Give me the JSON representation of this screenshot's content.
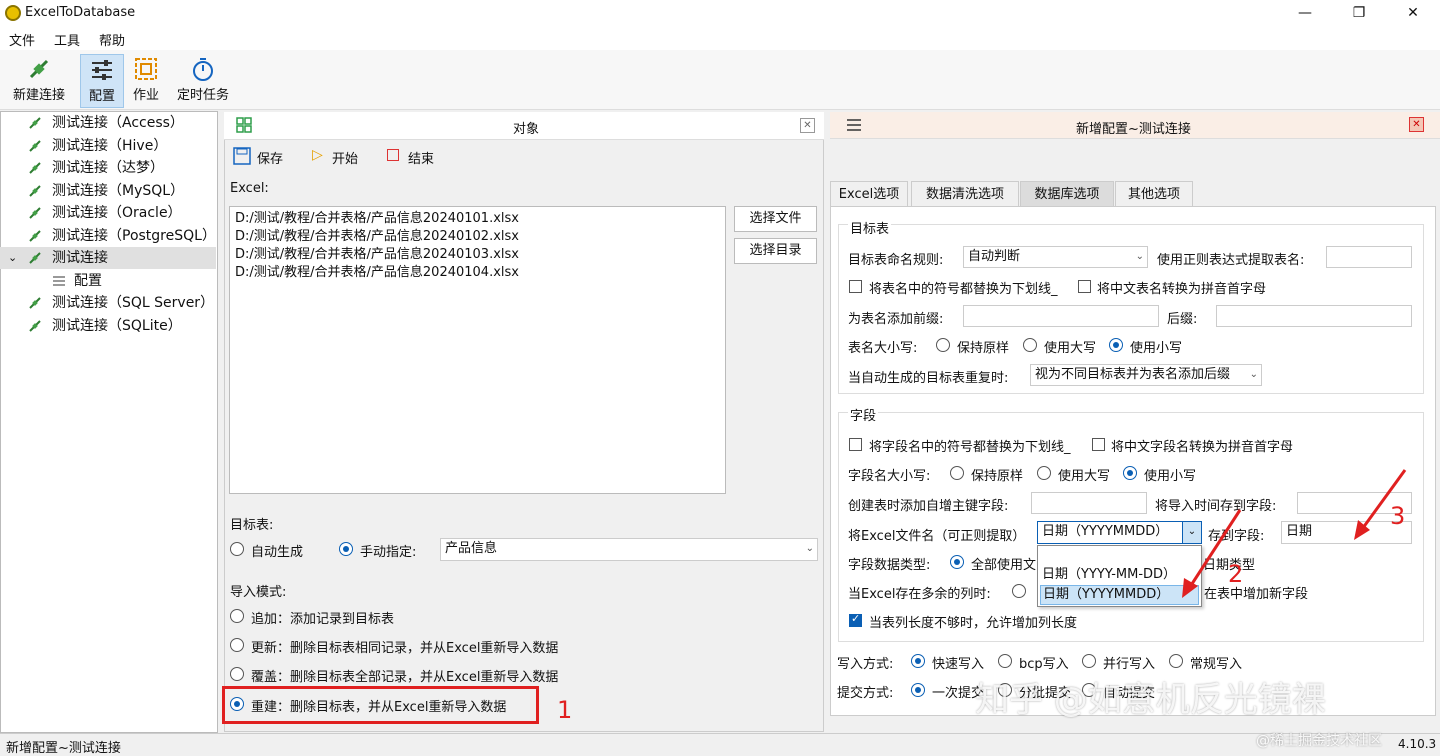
{
  "window": {
    "title": "ExcelToDatabase",
    "minimize": "—",
    "maximize": "❐",
    "close": "✕"
  },
  "menu": [
    "文件",
    "工具",
    "帮助"
  ],
  "toolbar": {
    "new_connection": "新建连接",
    "config": "配置",
    "job": "作业",
    "scheduled": "定时任务"
  },
  "tree": [
    "测试连接（Access）",
    "测试连接（Hive）",
    "测试连接（达梦）",
    "测试连接（MySQL）",
    "测试连接（Oracle）",
    "测试连接（PostgreSQL）",
    "测试连接",
    "配置",
    "测试连接（SQL Server）",
    "测试连接（SQLite）"
  ],
  "object_panel": {
    "title": "对象",
    "save": "保存",
    "start": "开始",
    "end": "结束",
    "excel_label": "Excel:",
    "files": [
      "D:/测试/教程/合并表格/产品信息20240101.xlsx",
      "D:/测试/教程/合并表格/产品信息20240102.xlsx",
      "D:/测试/教程/合并表格/产品信息20240103.xlsx",
      "D:/测试/教程/合并表格/产品信息20240104.xlsx"
    ],
    "select_file": "选择文件",
    "select_dir": "选择目录",
    "target_label": "目标表:",
    "auto_gen": "自动生成",
    "manual": "手动指定:",
    "target_value": "产品信息",
    "mode_label": "导入模式:",
    "modes": [
      "追加：添加记录到目标表",
      "更新：删除目标表相同记录，并从Excel重新导入数据",
      "覆盖：删除目标表全部记录，并从Excel重新导入数据",
      "重建：删除目标表，并从Excel重新导入数据"
    ]
  },
  "config_panel": {
    "title": "新增配置~测试连接",
    "tabs": [
      "Excel选项",
      "数据清洗选项",
      "数据库选项",
      "其他选项"
    ],
    "target_group": "目标表",
    "naming_rule_label": "目标表命名规则:",
    "naming_rule_value": "自动判断",
    "regex_label": "使用正则表达式提取表名:",
    "replace_symbols": "将表名中的符号都替换为下划线_",
    "pinyin_table": "将中文表名转换为拼音首字母",
    "prefix_label": "为表名添加前缀:",
    "suffix_label": "后缀:",
    "case_label": "表名大小写:",
    "keep": "保持原样",
    "upper": "使用大写",
    "lower": "使用小写",
    "dup_label": "当自动生成的目标表重复时:",
    "dup_value": "视为不同目标表并为表名添加后缀",
    "field_group": "字段",
    "replace_field_symbols": "将字段名中的符号都替换为下划线_",
    "pinyin_field": "将中文字段名转换为拼音首字母",
    "field_case_label": "字段名大小写:",
    "autoinc_label": "创建表时添加自增主键字段:",
    "import_time_label": "将导入时间存到字段:",
    "excel_name_label": "将Excel文件名（可正则提取）",
    "excel_name_value": "日期（YYYYMMDD）",
    "store_field_label": "存到字段:",
    "store_field_value": "日期",
    "data_type_label": "字段数据类型:",
    "data_type_value": "全部使用文",
    "date_type_tail": "日期类型",
    "extra_col_label": "当Excel存在多余的列时:",
    "extra_col_tail": "在表中增加新字段",
    "extend_len": "当表列长度不够时，允许增加列长度",
    "dropdown": [
      "日期（YYYY-MM-DD）",
      "日期（YYYYMMDD）"
    ],
    "write_label": "写入方式:",
    "write_opts": [
      "快速写入",
      "bcp写入",
      "并行写入",
      "常规写入"
    ],
    "commit_label": "提交方式:",
    "commit_opts": [
      "一次提交",
      "分批提交",
      "自动提交"
    ]
  },
  "annotations": [
    "1",
    "2",
    "3"
  ],
  "status": {
    "left": "新增配置~测试连接",
    "right": "4.10.3"
  },
  "watermarks": [
    "知乎 @如意机反光镜裸",
    "@稀土掘金技术社区"
  ],
  "colors": {
    "accent": "#0a5fb4",
    "annotation": "#e02020"
  }
}
